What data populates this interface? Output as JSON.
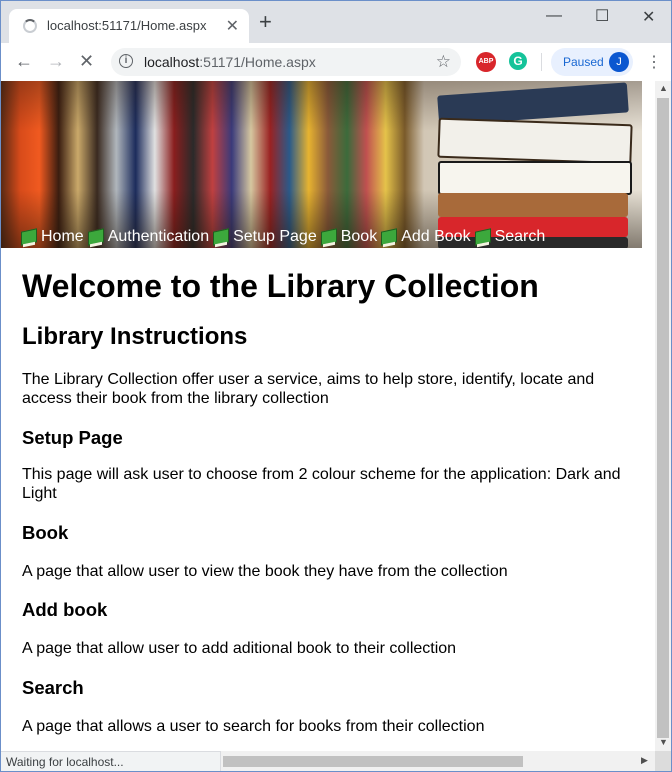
{
  "browser": {
    "tab_title": "localhost:51171/Home.aspx",
    "url_host": "localhost",
    "url_path": ":51171/Home.aspx",
    "profile_status": "Paused",
    "profile_initial": "J",
    "status_text": "Waiting for localhost...",
    "icons": {
      "loading": "spinner-icon",
      "close": "close-icon",
      "new_tab": "plus-icon",
      "back": "back-arrow-icon",
      "forward": "forward-arrow-icon",
      "stop": "stop-icon",
      "info": "info-icon",
      "bookmark": "star-icon",
      "adblock": "adblock-icon",
      "grammarly": "grammarly-icon",
      "menu": "kebab-menu-icon"
    },
    "colors": {
      "accent": "#1967d2",
      "abp": "#d8262b",
      "grammarly": "#15c39a"
    }
  },
  "nav": {
    "items": [
      {
        "label": "Home"
      },
      {
        "label": "Authentication"
      },
      {
        "label": "Setup Page"
      },
      {
        "label": "Book"
      },
      {
        "label": "Add Book"
      },
      {
        "label": "Search"
      }
    ]
  },
  "page": {
    "title": "Welcome to the Library Collection",
    "instructions_heading": "Library Instructions",
    "intro": "The Library Collection offer user a service, aims to help store, identify, locate and access their book from the library collection",
    "sections": [
      {
        "heading": "Setup Page",
        "text": "This page will ask user to choose from 2 colour scheme for the application: Dark and Light"
      },
      {
        "heading": "Book",
        "text": "A page that allow user to view the book they have from the collection"
      },
      {
        "heading": "Add book",
        "text": "A page that allow user to add aditional book to their collection"
      },
      {
        "heading": "Search",
        "text": "A page that allows a user to search for books from their collection"
      }
    ]
  }
}
